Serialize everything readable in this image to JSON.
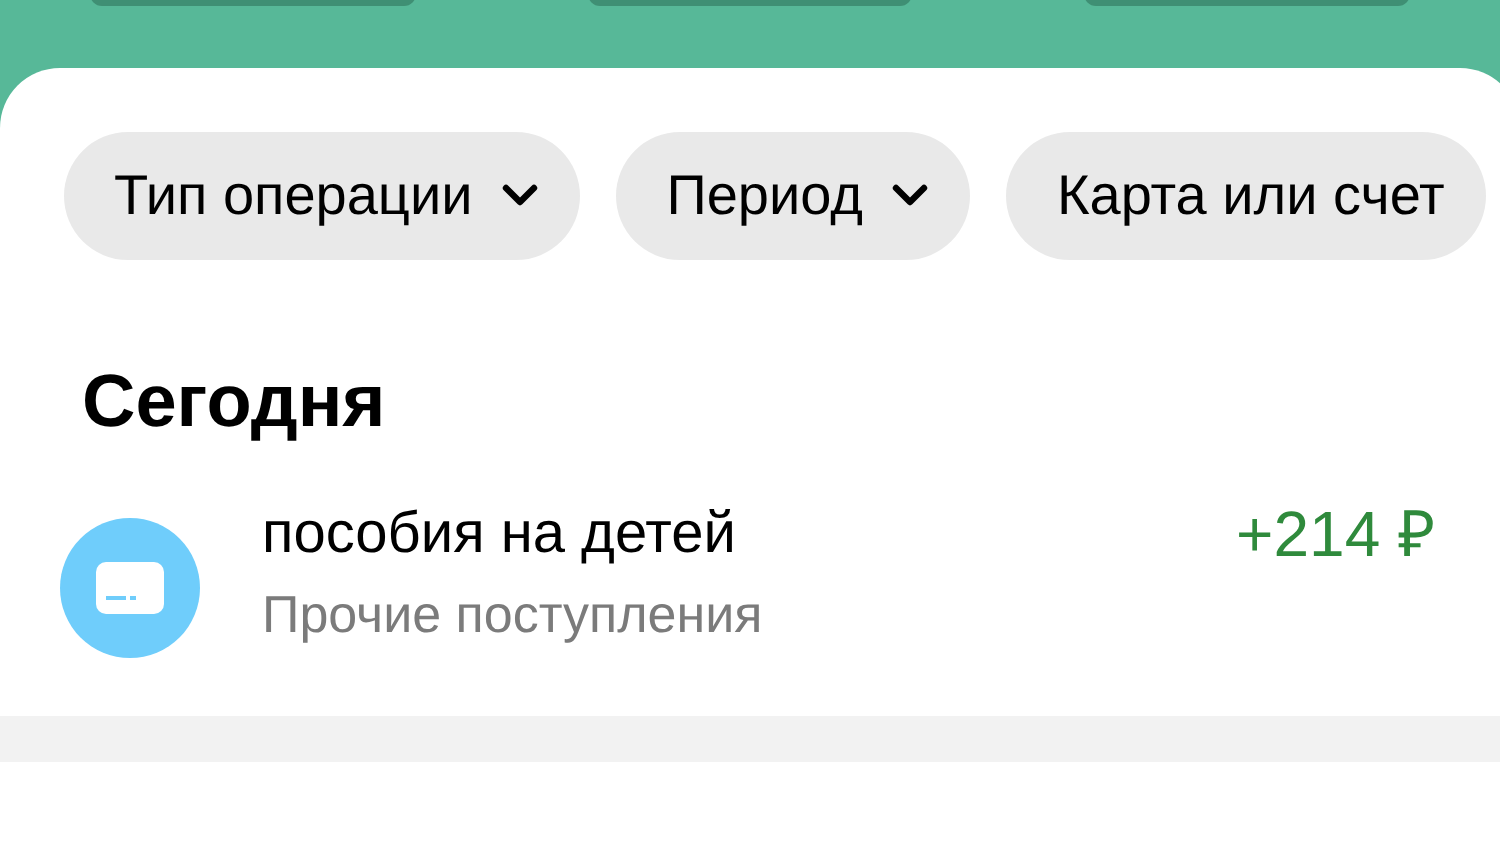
{
  "filters": [
    {
      "label": "Тип операции",
      "chevron": true
    },
    {
      "label": "Период",
      "chevron": true
    },
    {
      "label": "Карта или счет",
      "chevron": false
    }
  ],
  "section_title": "Сегодня",
  "operations": [
    {
      "title": "пособия на детей",
      "category": "Прочие поступления",
      "amount": "+214 ₽",
      "kind": "income"
    }
  ]
}
